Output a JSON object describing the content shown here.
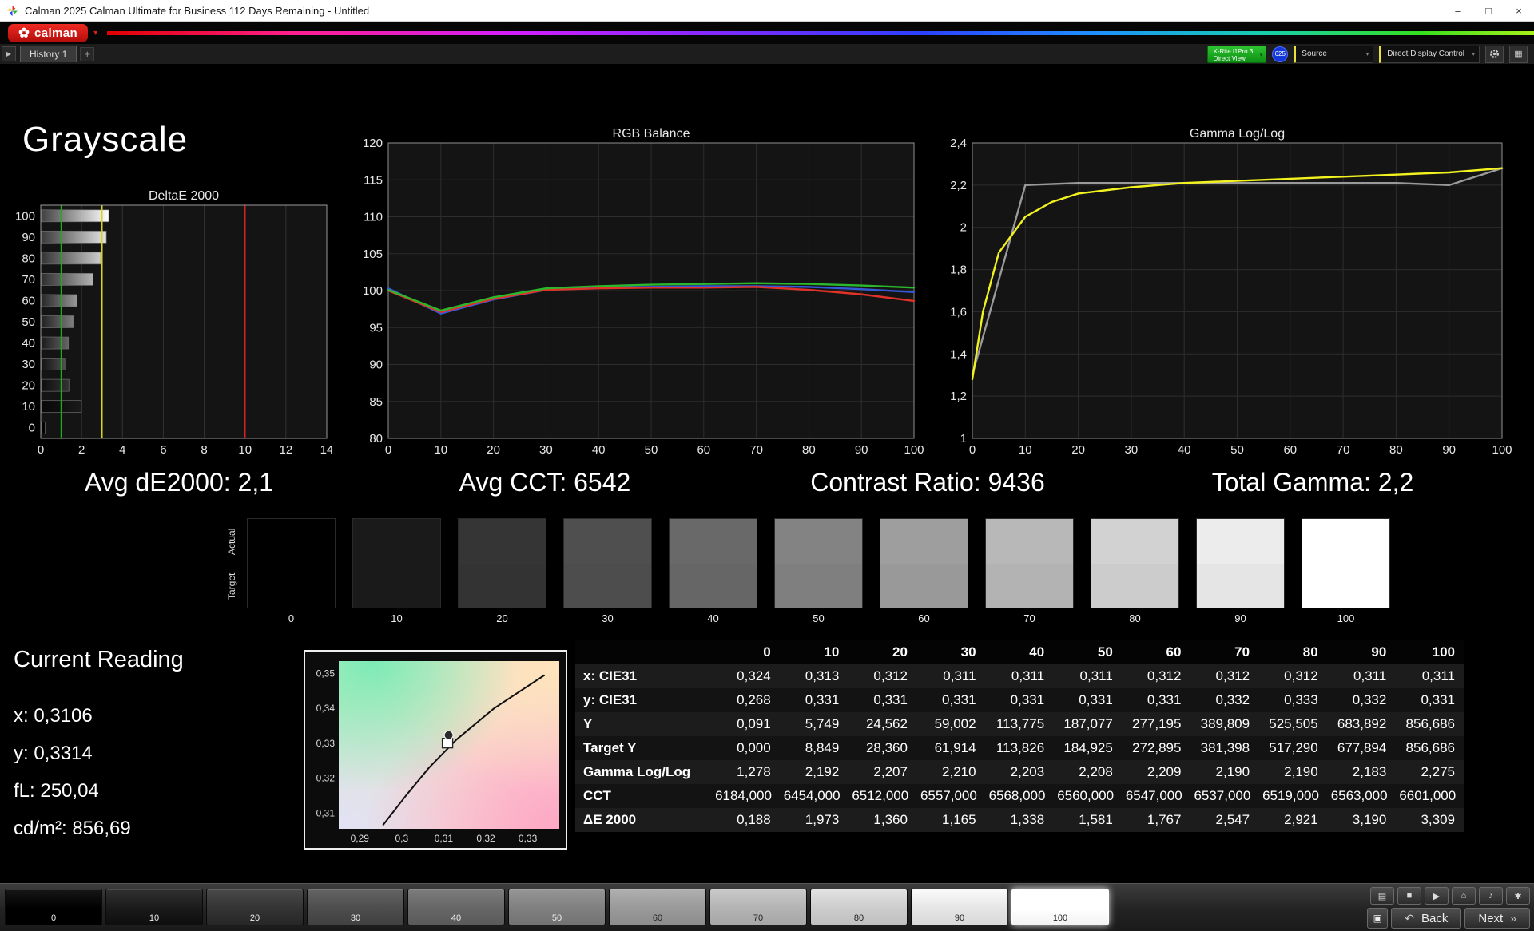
{
  "window": {
    "title": "Calman 2025 Calman Ultimate for Business 112 Days Remaining  - Untitled",
    "controls": {
      "minimize": "–",
      "maximize": "□",
      "close": "×"
    }
  },
  "icons": {
    "caret": "▾",
    "chevron_right": "▶",
    "grid": "▦"
  },
  "brand": {
    "logo_text": "calman"
  },
  "toolbar": {
    "history_tab": "History 1",
    "add_tab": "+",
    "meter_button": {
      "line1": "X-Rite i1Pro 3",
      "line2": "Direct View"
    },
    "meter_badge": "625",
    "source_button": "Source",
    "display_control_button": "Direct Display Control"
  },
  "page": {
    "heading": "Grayscale"
  },
  "stats": {
    "avg_de": "Avg dE2000: 2,1",
    "avg_cct": "Avg CCT: 6542",
    "contrast": "Contrast Ratio: 9436",
    "total_gamma": "Total Gamma: 2,2"
  },
  "chart_data": [
    {
      "type": "bar",
      "orientation": "horizontal",
      "title": "DeltaE 2000",
      "categories": [
        "100",
        "90",
        "80",
        "70",
        "60",
        "50",
        "40",
        "30",
        "20",
        "10",
        "0"
      ],
      "bar_levels": [
        100,
        90,
        80,
        70,
        60,
        50,
        40,
        30,
        20,
        10,
        0
      ],
      "values": [
        3.309,
        3.19,
        2.921,
        2.547,
        1.767,
        1.581,
        1.338,
        1.165,
        1.36,
        1.973,
        0.188
      ],
      "xlim": [
        0,
        14
      ],
      "xticks": [
        0,
        2,
        4,
        6,
        8,
        10,
        12,
        14
      ],
      "ref_lines": [
        {
          "value": 1,
          "color": "#1faa1f"
        },
        {
          "value": 3,
          "color": "#d6d61f"
        },
        {
          "value": 10,
          "color": "#d42020"
        }
      ],
      "grid": true,
      "legend": "none"
    },
    {
      "type": "line",
      "title": "RGB Balance",
      "x": [
        0,
        10,
        20,
        30,
        40,
        50,
        60,
        70,
        80,
        90,
        100
      ],
      "xlim": [
        0,
        100
      ],
      "xticks": [
        0,
        10,
        20,
        30,
        40,
        50,
        60,
        70,
        80,
        90,
        100
      ],
      "ylim": [
        80,
        120
      ],
      "yticks": [
        80,
        85,
        90,
        95,
        100,
        105,
        110,
        115,
        120
      ],
      "grid": true,
      "legend": "none",
      "series": [
        {
          "name": "Blue",
          "color": "#3558d8",
          "values": [
            100.3,
            96.9,
            98.8,
            100.1,
            100.4,
            100.5,
            100.6,
            100.6,
            100.5,
            100.2,
            99.8
          ]
        },
        {
          "name": "Red",
          "color": "#e03228",
          "values": [
            100.0,
            97.1,
            98.9,
            100.1,
            100.3,
            100.4,
            100.4,
            100.5,
            100.1,
            99.5,
            98.6
          ]
        },
        {
          "name": "Green",
          "color": "#2cb82c",
          "values": [
            100.1,
            97.3,
            99.1,
            100.3,
            100.6,
            100.8,
            100.9,
            101.0,
            100.9,
            100.7,
            100.4
          ]
        }
      ]
    },
    {
      "type": "line",
      "title": "Gamma Log/Log",
      "x": [
        0,
        10,
        20,
        30,
        40,
        50,
        60,
        70,
        80,
        90,
        100
      ],
      "xlim": [
        0,
        100
      ],
      "xticks": [
        0,
        10,
        20,
        30,
        40,
        50,
        60,
        70,
        80,
        90,
        100
      ],
      "ylim": [
        1,
        2.4
      ],
      "yticks": [
        1,
        1.2,
        1.4,
        1.6,
        1.8,
        2,
        2.2,
        2.4
      ],
      "ytick_labels": [
        "1",
        "1,2",
        "1,4",
        "1,6",
        "1,8",
        "2",
        "2,2",
        "2,4"
      ],
      "grid": true,
      "legend": "none",
      "series": [
        {
          "name": "Target gamma",
          "color": "#9a9a9a",
          "x": [
            0,
            10,
            20,
            30,
            40,
            50,
            60,
            70,
            80,
            90,
            100
          ],
          "values": [
            1.3,
            2.2,
            2.21,
            2.21,
            2.21,
            2.21,
            2.21,
            2.21,
            2.21,
            2.2,
            2.28
          ]
        },
        {
          "name": "Measured gamma",
          "color": "#f2f21e",
          "x": [
            0,
            2,
            5,
            10,
            15,
            20,
            30,
            40,
            50,
            60,
            70,
            80,
            90,
            100
          ],
          "values": [
            1.28,
            1.6,
            1.88,
            2.05,
            2.12,
            2.16,
            2.19,
            2.21,
            2.22,
            2.23,
            2.24,
            2.25,
            2.26,
            2.28
          ]
        }
      ]
    },
    {
      "type": "scatter",
      "title": "",
      "xlim": [
        0.285,
        0.3375
      ],
      "ylim": [
        0.3055,
        0.3535
      ],
      "xticks": [
        0.29,
        0.3,
        0.31,
        0.32,
        0.33
      ],
      "xtick_labels": [
        "0,29",
        "0,3",
        "0,31",
        "0,32",
        "0,33"
      ],
      "yticks": [
        0.31,
        0.32,
        0.33,
        0.34,
        0.35
      ],
      "ytick_labels": [
        "0,31",
        "0,32",
        "0,33",
        "0,34",
        "0,35"
      ],
      "locus": [
        [
          0.2955,
          0.3065
        ],
        [
          0.301,
          0.315
        ],
        [
          0.3065,
          0.323
        ],
        [
          0.313,
          0.331
        ],
        [
          0.322,
          0.34
        ],
        [
          0.334,
          0.3495
        ]
      ],
      "point": {
        "x": 0.3106,
        "y": 0.3314
      }
    }
  ],
  "swatch_strip": {
    "row_labels": [
      "Actual",
      "Target"
    ],
    "levels": [
      0,
      10,
      20,
      30,
      40,
      50,
      60,
      70,
      80,
      90,
      100
    ]
  },
  "current_reading": {
    "title": "Current Reading",
    "lines": [
      "x: 0,3106",
      "y: 0,3314",
      "fL: 250,04",
      "cd/m²: 856,69"
    ]
  },
  "table": {
    "columns": [
      "",
      "0",
      "10",
      "20",
      "30",
      "40",
      "50",
      "60",
      "70",
      "80",
      "90",
      "100"
    ],
    "rows": [
      {
        "label": "x: CIE31",
        "values": [
          "0,324",
          "0,313",
          "0,312",
          "0,311",
          "0,311",
          "0,311",
          "0,312",
          "0,312",
          "0,312",
          "0,311",
          "0,311"
        ]
      },
      {
        "label": "y: CIE31",
        "values": [
          "0,268",
          "0,331",
          "0,331",
          "0,331",
          "0,331",
          "0,331",
          "0,331",
          "0,332",
          "0,333",
          "0,332",
          "0,331"
        ]
      },
      {
        "label": "Y",
        "values": [
          "0,091",
          "5,749",
          "24,562",
          "59,002",
          "113,775",
          "187,077",
          "277,195",
          "389,809",
          "525,505",
          "683,892",
          "856,686"
        ]
      },
      {
        "label": "Target Y",
        "values": [
          "0,000",
          "8,849",
          "28,360",
          "61,914",
          "113,826",
          "184,925",
          "272,895",
          "381,398",
          "517,290",
          "677,894",
          "856,686"
        ]
      },
      {
        "label": "Gamma Log/Log",
        "values": [
          "1,278",
          "2,192",
          "2,207",
          "2,210",
          "2,203",
          "2,208",
          "2,209",
          "2,190",
          "2,190",
          "2,183",
          "2,275"
        ]
      },
      {
        "label": "CCT",
        "values": [
          "6184,000",
          "6454,000",
          "6512,000",
          "6557,000",
          "6568,000",
          "6560,000",
          "6547,000",
          "6537,000",
          "6519,000",
          "6563,000",
          "6601,000"
        ]
      },
      {
        "label": "ΔE 2000",
        "values": [
          "0,188",
          "1,973",
          "1,360",
          "1,165",
          "1,338",
          "1,581",
          "1,767",
          "2,547",
          "2,921",
          "3,190",
          "3,309"
        ]
      }
    ]
  },
  "bottom_bar": {
    "levels": [
      0,
      10,
      20,
      30,
      40,
      50,
      60,
      70,
      80,
      90,
      100
    ],
    "selected_level": 100
  },
  "nav": {
    "small_buttons": [
      {
        "name": "display",
        "glyph": "▤"
      },
      {
        "name": "stop",
        "glyph": "■"
      },
      {
        "name": "play",
        "glyph": "▶"
      },
      {
        "name": "home",
        "glyph": "⌂"
      },
      {
        "name": "notes",
        "glyph": "♪"
      },
      {
        "name": "settings",
        "glyph": "✱"
      }
    ],
    "check_glyph": "▣",
    "back_label": "Back",
    "back_glyph": "↶",
    "next_label": "Next",
    "next_glyph": "»"
  }
}
